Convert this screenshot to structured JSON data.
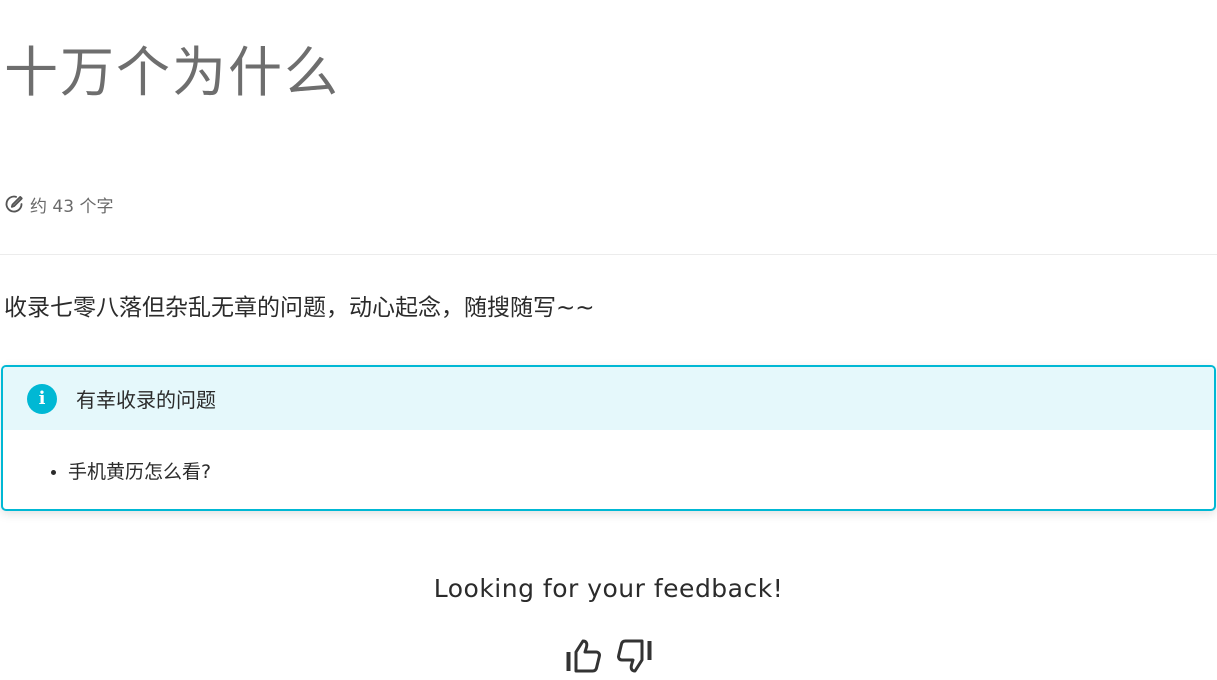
{
  "page": {
    "title": "十万个为什么",
    "meta": {
      "icon": "edit-circle-icon",
      "word_count": "约 43 个字"
    },
    "intro": "收录七零八落但杂乱无章的问题，动心起念，随搜随写~~"
  },
  "admonition": {
    "type": "info",
    "icon": "info-circle-icon",
    "accent_color": "#00b8d4",
    "title": "有幸收录的问题",
    "items": [
      {
        "label": "手机黄历怎么看?"
      }
    ]
  },
  "feedback": {
    "title": "Looking for your feedback!",
    "buttons": [
      {
        "icon": "thumbs-up-icon"
      },
      {
        "icon": "thumbs-down-icon"
      }
    ]
  }
}
